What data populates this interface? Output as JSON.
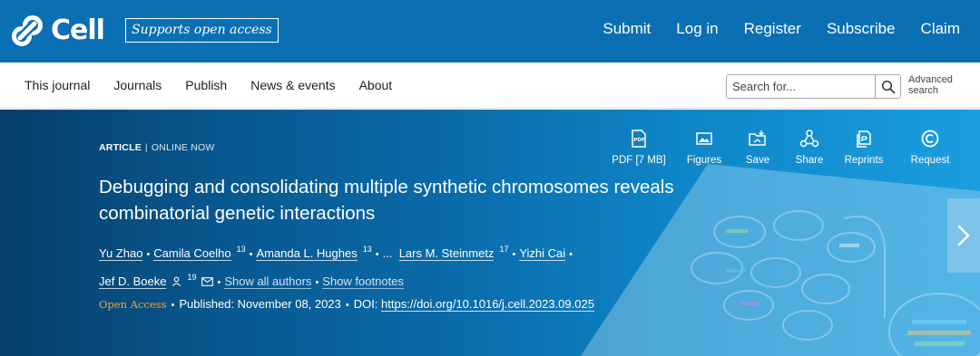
{
  "brand": {
    "logo_text": "Cell",
    "tagline": "Supports open access"
  },
  "topnav": {
    "submit": "Submit",
    "login": "Log in",
    "register": "Register",
    "subscribe": "Subscribe",
    "claim": "Claim"
  },
  "subnav": {
    "journal": "This journal",
    "journals": "Journals",
    "publish": "Publish",
    "news": "News & events",
    "about": "About"
  },
  "search": {
    "placeholder": "Search for...",
    "advanced": "Advanced search"
  },
  "article": {
    "type": "ARTICLE",
    "separator": "|",
    "status": "ONLINE NOW",
    "title": "Debugging and consolidating multiple synthetic chromosomes reveals combinatorial genetic interactions",
    "authors": [
      {
        "name": "Yu Zhao"
      },
      {
        "name": "Camila Coelho",
        "sup": "13"
      },
      {
        "name": "Amanda L. Hughes",
        "sup": "13"
      },
      {
        "name": "Lars M. Steinmetz",
        "sup": "17"
      },
      {
        "name": "Yizhi Cai"
      },
      {
        "name": "Jef D. Boeke",
        "sup": "19"
      }
    ],
    "ellipsis": "...",
    "show_all_authors": "Show all authors",
    "show_footnotes": "Show footnotes",
    "open_access": "Open Access",
    "published": "Published: November 08, 2023",
    "doi_label": "DOI:",
    "doi": "https://doi.org/10.1016/j.cell.2023.09.025"
  },
  "actions": {
    "pdf": "PDF [7 MB]",
    "figures": "Figures",
    "save": "Save",
    "share": "Share",
    "reprints": "Reprints",
    "request": "Request"
  },
  "colors": {
    "header_blue": "#0b6fb4",
    "open_access_orange": "#f2a33a",
    "hero_dark": "#063f6b",
    "hero_light": "#1a9ee0"
  }
}
